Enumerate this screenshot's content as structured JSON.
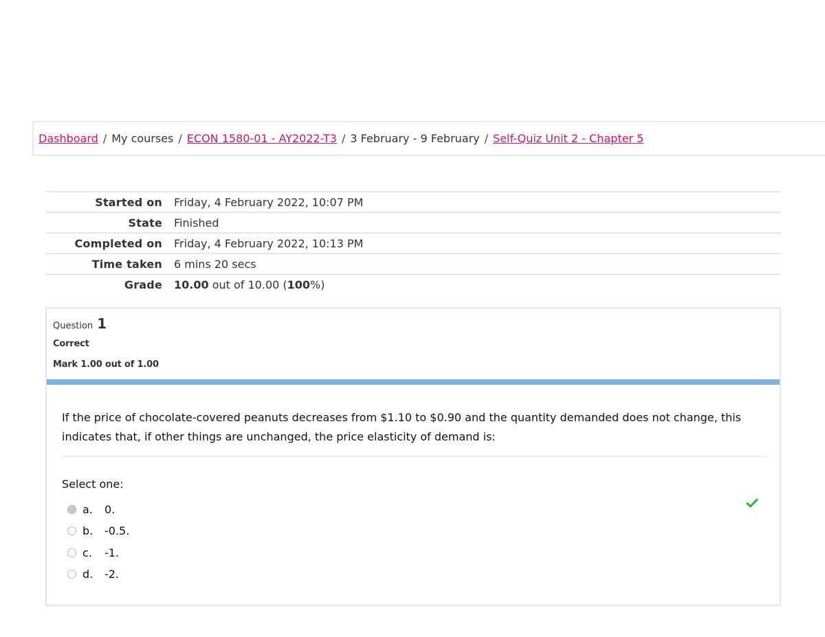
{
  "breadcrumb": {
    "items": [
      {
        "label": "Dashboard",
        "link": true
      },
      {
        "label": "My courses",
        "link": false
      },
      {
        "label": "ECON 1580-01 - AY2022-T3",
        "link": true
      },
      {
        "label": "3 February - 9 February",
        "link": false
      },
      {
        "label": "Self-Quiz Unit 2 - Chapter 5",
        "link": true
      }
    ],
    "separator": "/"
  },
  "summary": {
    "started_label": "Started on",
    "started_value": "Friday, 4 February 2022, 10:07 PM",
    "state_label": "State",
    "state_value": "Finished",
    "completed_label": "Completed on",
    "completed_value": "Friday, 4 February 2022, 10:13 PM",
    "time_label": "Time taken",
    "time_value": "6 mins 20 secs",
    "grade_label": "Grade",
    "grade_score": "10.00",
    "grade_rest": "out of 10.00 (",
    "grade_percent": "100",
    "grade_end": "%)"
  },
  "question": {
    "prefix": "Question",
    "number": "1",
    "state": "Correct",
    "mark": "Mark 1.00 out of 1.00",
    "text": "If the price of chocolate-covered peanuts decreases from $1.10 to $0.90 and the quantity demanded does not change, this indicates that, if other things are unchanged, the price elasticity of demand is:",
    "select_label": "Select one:",
    "options": [
      {
        "letter": "a.",
        "value": "0.",
        "selected": true
      },
      {
        "letter": "b.",
        "value": "-0.5.",
        "selected": false
      },
      {
        "letter": "c.",
        "value": "-1.",
        "selected": false
      },
      {
        "letter": "d.",
        "value": "-2.",
        "selected": false
      }
    ],
    "correct_icon": "check-icon",
    "correct_color": "#2bb52b",
    "band_color": "#7fb3dd"
  },
  "colors": {
    "link": "#d6126b"
  }
}
